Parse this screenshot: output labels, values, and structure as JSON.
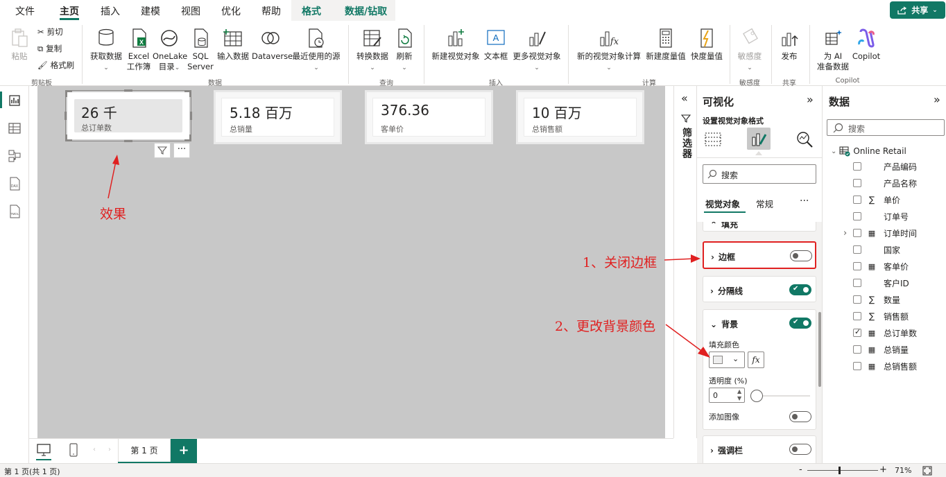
{
  "menu": {
    "items": [
      "文件",
      "主页",
      "插入",
      "建模",
      "视图",
      "优化",
      "帮助",
      "格式",
      "数据/钻取"
    ],
    "active": "主页",
    "share": "共享"
  },
  "ribbon": {
    "clipboard": {
      "paste": "粘贴",
      "cut": "剪切",
      "copy": "复制",
      "format_painter": "格式刷",
      "group": "剪贴板"
    },
    "data": {
      "get_data": "获取数据",
      "excel_line1": "Excel",
      "excel_line2": "工作簿",
      "onelake_line1": "OneLake",
      "onelake_line2": "目录",
      "sql_line1": "SQL",
      "sql_line2": "Server",
      "enter_data": "输入数据",
      "dataverse": "Dataverse",
      "recent": "最近使用的源",
      "group": "数据"
    },
    "query": {
      "transform": "转换数据",
      "refresh": "刷新",
      "group": "查询"
    },
    "insert": {
      "new_visual": "新建视觉对象",
      "textbox": "文本框",
      "more_visuals": "更多视觉对象",
      "group": "插入"
    },
    "calc": {
      "new_visual_calc": "新的视觉对象计算",
      "new_measure": "新建度量值",
      "quick_measure": "快度量值",
      "group": "计算"
    },
    "sensitivity": {
      "label": "敏感度",
      "group": "敏感度"
    },
    "share": {
      "publish": "发布",
      "group": "共享"
    },
    "copilot": {
      "prepare_line1": "为 AI",
      "prepare_line2": "准备数据",
      "copilot": "Copilot",
      "group": "Copilot"
    }
  },
  "cards": [
    {
      "value": "26 千",
      "label": "总订单数"
    },
    {
      "value": "5.18 百万",
      "label": "总销量"
    },
    {
      "value": "376.36",
      "label": "客单价"
    },
    {
      "value": "10 百万",
      "label": "总销售额"
    }
  ],
  "annotations": {
    "effect": "效果",
    "step1": "1、关闭边框",
    "step2": "2、更改背景颜色"
  },
  "tabs": {
    "page1": "第 1 页",
    "add": "+"
  },
  "status": {
    "pages": "第 1 页(共 1 页)",
    "zoom": "71%",
    "zoom_level": 0.45
  },
  "filters": {
    "label": "筛选器"
  },
  "viz_pane": {
    "title": "可视化",
    "subtitle": "设置视觉对象格式",
    "search_placeholder": "搜索",
    "tab_visual": "视觉对象",
    "tab_general": "常规",
    "more": "···",
    "section_fill_partial": "填充",
    "section_border": "边框",
    "border_on": false,
    "section_divider": "分隔线",
    "divider_on": true,
    "section_background": "背景",
    "background_on": true,
    "fill_color_label": "填充颜色",
    "fill_color": "#eeeeee",
    "fx": "fx",
    "transparency_label": "透明度 (%)",
    "transparency_value": "0",
    "add_image": "添加图像",
    "add_image_on": false,
    "section_accent": "强调栏",
    "accent_on": false
  },
  "data_pane": {
    "title": "数据",
    "search_placeholder": "搜索",
    "table": "Online Retail",
    "fields": [
      {
        "name": "产品编码",
        "type": "",
        "checked": false
      },
      {
        "name": "产品名称",
        "type": "",
        "checked": false
      },
      {
        "name": "单价",
        "type": "sigma",
        "checked": false
      },
      {
        "name": "订单号",
        "type": "",
        "checked": false
      },
      {
        "name": "订单时间",
        "type": "calendar",
        "checked": false
      },
      {
        "name": "国家",
        "type": "",
        "checked": false
      },
      {
        "name": "客单价",
        "type": "calc",
        "checked": false
      },
      {
        "name": "客户ID",
        "type": "",
        "checked": false
      },
      {
        "name": "数量",
        "type": "sigma",
        "checked": false
      },
      {
        "name": "销售额",
        "type": "sigma",
        "checked": false
      },
      {
        "name": "总订单数",
        "type": "calc",
        "checked": true
      },
      {
        "name": "总销量",
        "type": "calc",
        "checked": false
      },
      {
        "name": "总销售额",
        "type": "calc",
        "checked": false
      }
    ]
  },
  "colors": {
    "accent": "#117865",
    "annotation": "#e02020",
    "canvas": "#c8c8c8"
  }
}
